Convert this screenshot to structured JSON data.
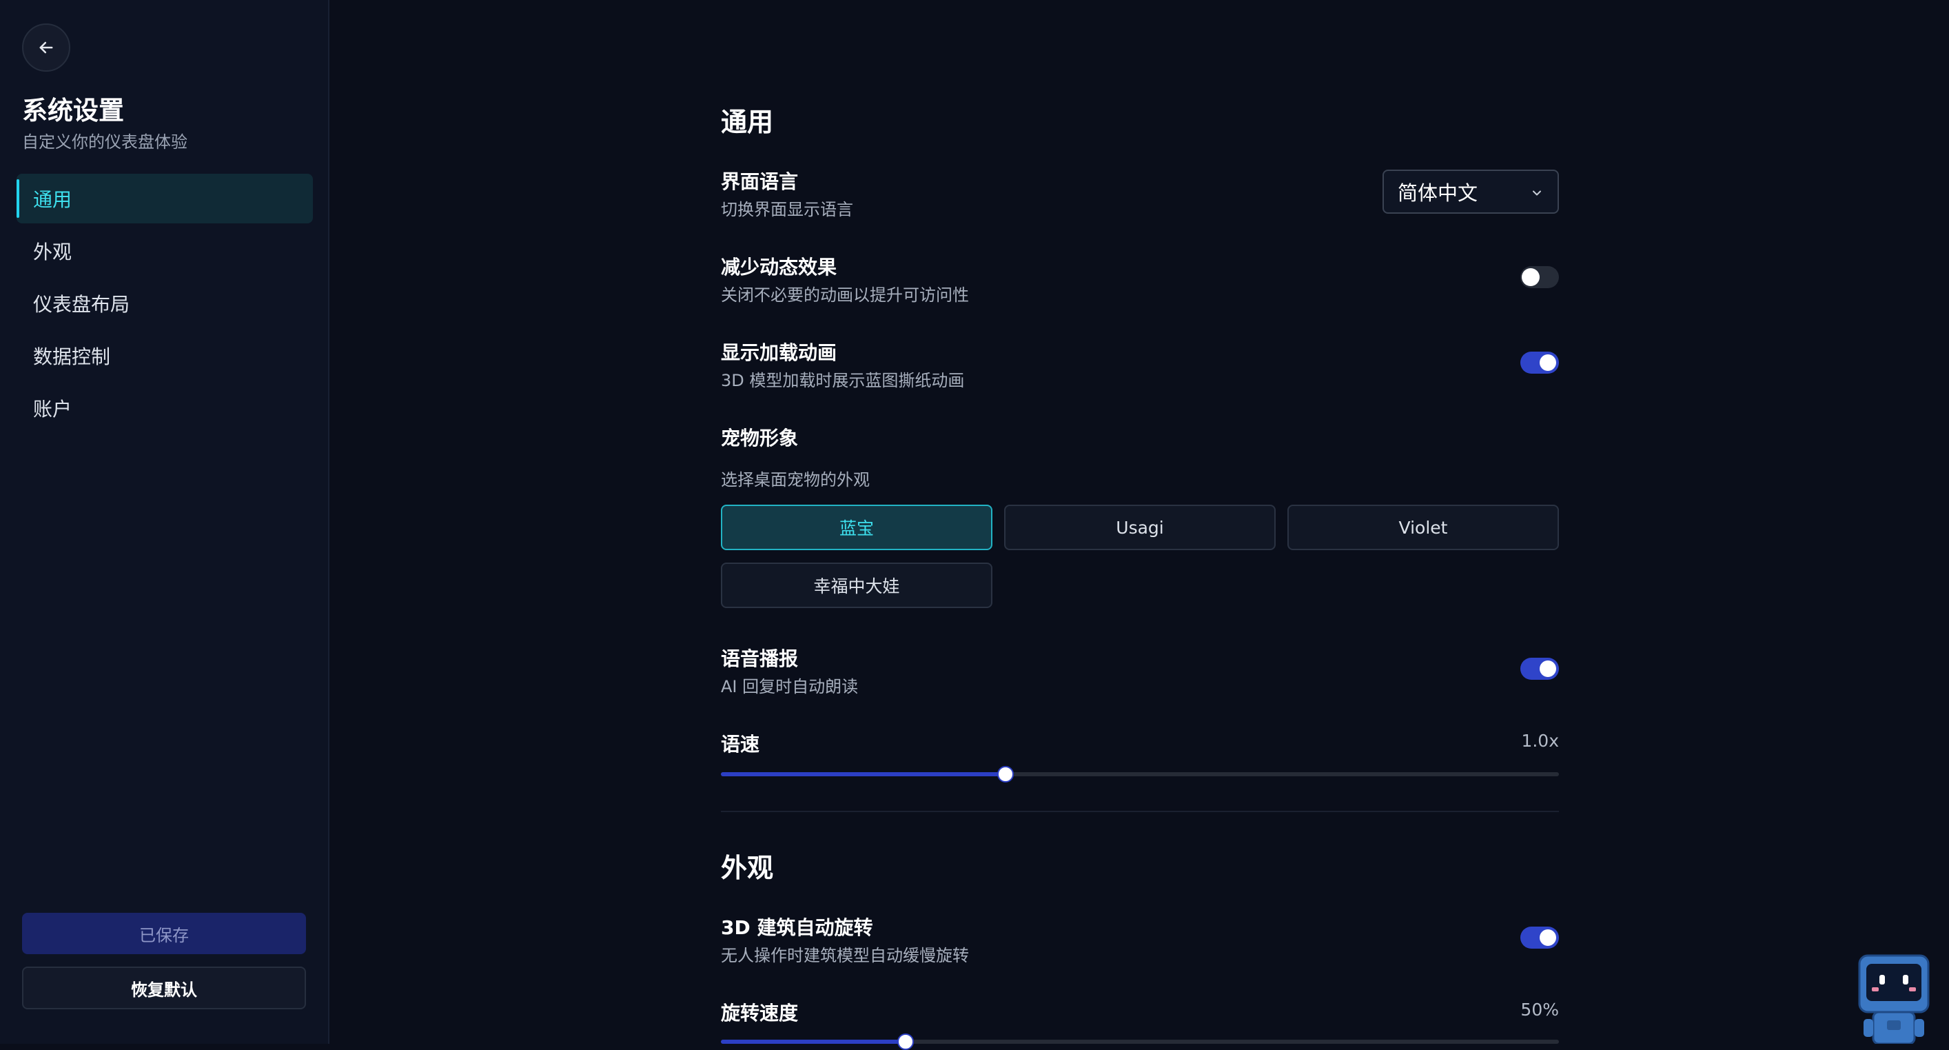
{
  "sidebar": {
    "title": "系统设置",
    "subtitle": "自定义你的仪表盘体验",
    "nav": [
      {
        "label": "通用",
        "active": true
      },
      {
        "label": "外观",
        "active": false
      },
      {
        "label": "仪表盘布局",
        "active": false
      },
      {
        "label": "数据控制",
        "active": false
      },
      {
        "label": "账户",
        "active": false
      }
    ],
    "saved_label": "已保存",
    "reset_label": "恢复默认"
  },
  "general": {
    "title": "通用",
    "language": {
      "label": "界面语言",
      "desc": "切换界面显示语言",
      "value": "简体中文"
    },
    "reduce_motion": {
      "label": "减少动态效果",
      "desc": "关闭不必要的动画以提升可访问性",
      "on": false
    },
    "loading_anim": {
      "label": "显示加载动画",
      "desc": "3D 模型加载时展示蓝图撕纸动画",
      "on": true
    },
    "pet": {
      "label": "宠物形象",
      "desc": "选择桌面宠物的外观",
      "options": [
        "蓝宝",
        "Usagi",
        "Violet",
        "幸福中大娃"
      ],
      "selected": "蓝宝"
    },
    "voice": {
      "label": "语音播报",
      "desc": "AI 回复时自动朗读",
      "on": true
    },
    "speech_rate": {
      "label": "语速",
      "value_text": "1.0x",
      "fraction": 0.34
    }
  },
  "appearance": {
    "title": "外观",
    "auto_rotate": {
      "label": "3D 建筑自动旋转",
      "desc": "无人操作时建筑模型自动缓慢旋转",
      "on": true
    },
    "rotate_speed": {
      "label": "旋转速度",
      "value_text": "50%",
      "fraction": 0.22
    }
  },
  "colors": {
    "accent": "#22d3ee",
    "toggle_on": "#2f44c9",
    "background": "#0a0e1a"
  },
  "icons": {
    "back": "arrow-left-icon",
    "dropdown": "chevron-down-icon",
    "pet": "robot-pet-icon"
  }
}
